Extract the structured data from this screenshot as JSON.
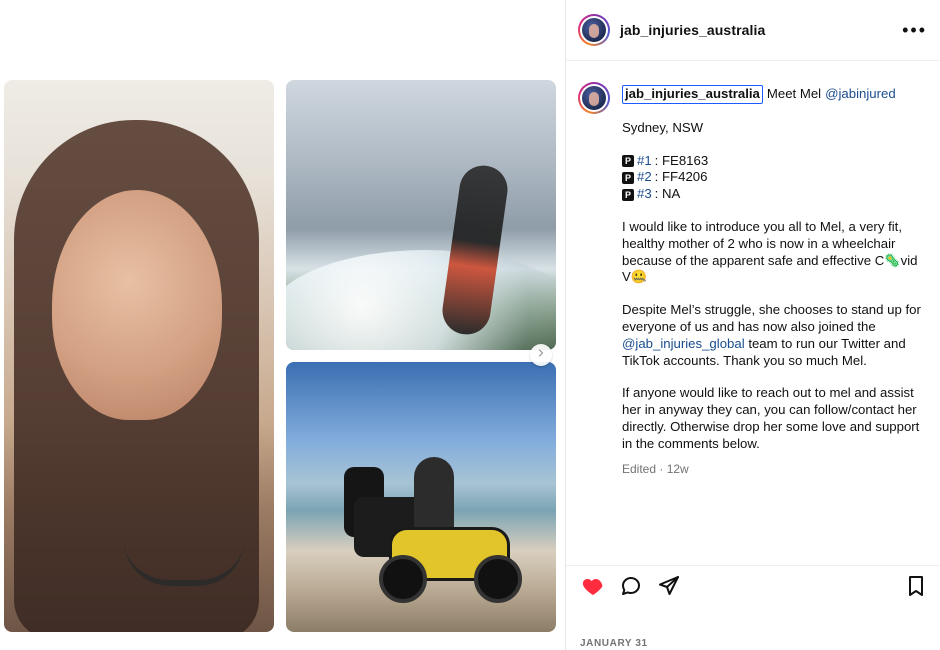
{
  "post": {
    "username": "jab_injuries_australia",
    "more_label": "•••",
    "caption": {
      "username": "jab_injuries_australia",
      "first_line_text": "Meet Mel",
      "mention": "@jabinjured",
      "location": "Sydney, NSW",
      "lots": [
        {
          "label": "#1",
          "value": ": FE8163"
        },
        {
          "label": "#2",
          "value": ": FF4206"
        },
        {
          "label": "#3",
          "value": ": NA"
        }
      ],
      "p1": "I would like to introduce you all to Mel, a very fit, healthy mother of 2 who is now in a wheelchair because of the apparent safe and effective C🦠vid V🤐",
      "p2_before": "Despite Mel’s struggle, she chooses to stand up for everyone of us and has now also joined the ",
      "p2_mention": "@jab_injuries_global",
      "p2_after": " team to run our Twitter and TikTok accounts. Thank you so much Mel.",
      "p3": "If anyone would like to reach out to mel and assist her in anyway they can, you can follow/contact her directly. Otherwise drop her some love and support in the comments below.",
      "meta": "Edited · 12w"
    },
    "date": "JANUARY 31"
  },
  "icons": {
    "more": "more-horizontal-icon",
    "next": "chevron-right-icon",
    "like": "heart-icon",
    "comment": "comment-icon",
    "share": "send-icon",
    "save": "bookmark-icon",
    "lot_badge": "p-square-icon"
  },
  "colors": {
    "like_red": "#ff2b3f",
    "link_blue": "#1b4d8f",
    "muted_gray": "#737373",
    "outline_blue": "#1a5cff"
  }
}
